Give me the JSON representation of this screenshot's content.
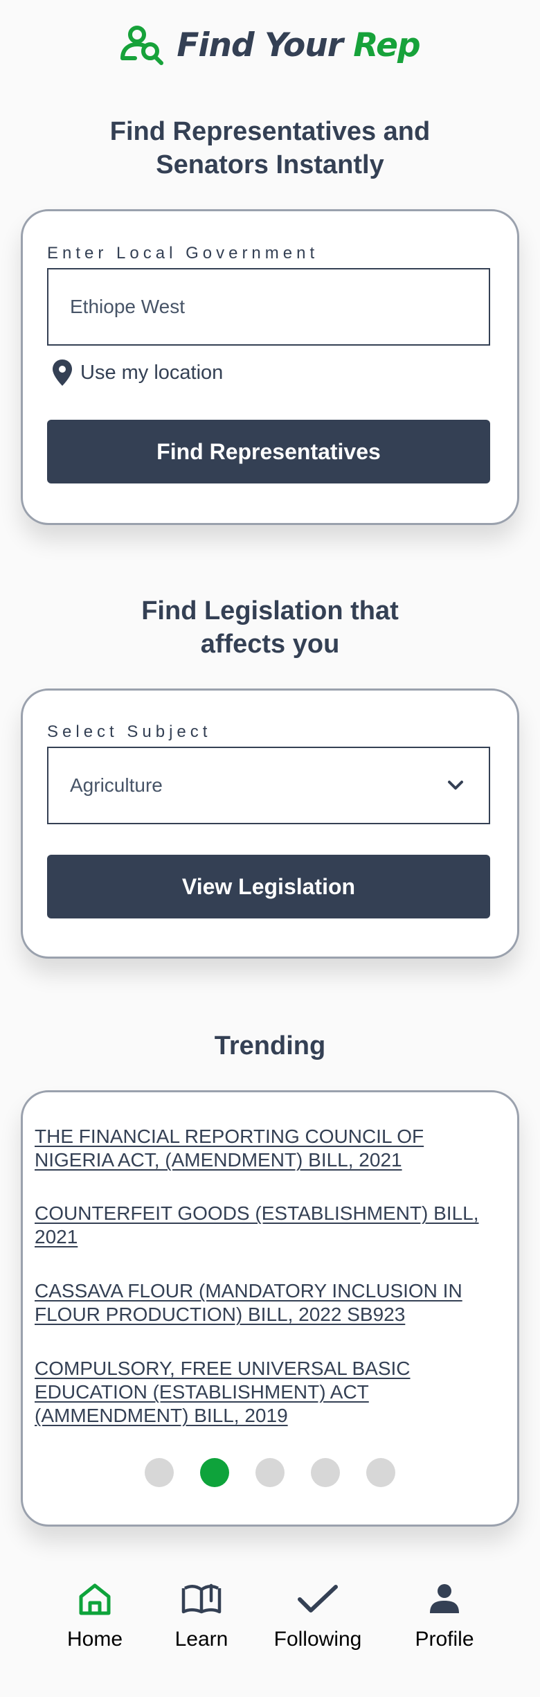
{
  "brand": {
    "name_main": "Find Your ",
    "name_accent": "Rep",
    "accent_color": "#17a23a",
    "icon": "person-search-icon"
  },
  "reps_section": {
    "title": "Find Representatives and\nSenators Instantly",
    "field_label": "Enter Local Government",
    "field_value": "Ethiope West",
    "location_label": "Use my location",
    "location_icon": "map-pin-icon",
    "button_label": "Find Representatives"
  },
  "legislation_section": {
    "title": "Find Legislation that\naffects you",
    "field_label": "Select Subject",
    "selected_subject": "Agriculture",
    "select_icon": "chevron-down-icon",
    "button_label": "View Legislation"
  },
  "trending": {
    "title": "Trending",
    "items": [
      "THE FINANCIAL REPORTING COUNCIL OF NIGERIA ACT, (AMENDMENT) BILL, 2021",
      "COUNTERFEIT GOODS (ESTABLISHMENT) BILL, 2021",
      "CASSAVA FLOUR (MANDATORY INCLUSION IN FLOUR PRODUCTION) BILL, 2022 SB923",
      "COMPULSORY, FREE UNIVERSAL BASIC EDUCATION (ESTABLISHMENT) ACT (AMMENDMENT) BILL, 2019"
    ],
    "pager": {
      "pages": 5,
      "active_page": 2
    }
  },
  "bottom_nav": {
    "items": [
      {
        "label": "Home",
        "icon": "home-icon",
        "active": true
      },
      {
        "label": "Learn",
        "icon": "book-icon",
        "active": false
      },
      {
        "label": "Following",
        "icon": "check-icon",
        "active": false
      },
      {
        "label": "Profile",
        "icon": "profile-icon",
        "active": false
      }
    ]
  },
  "colors": {
    "primary": "#344054",
    "accent": "#0ea33b",
    "dot_inactive": "#d7d7d7"
  }
}
